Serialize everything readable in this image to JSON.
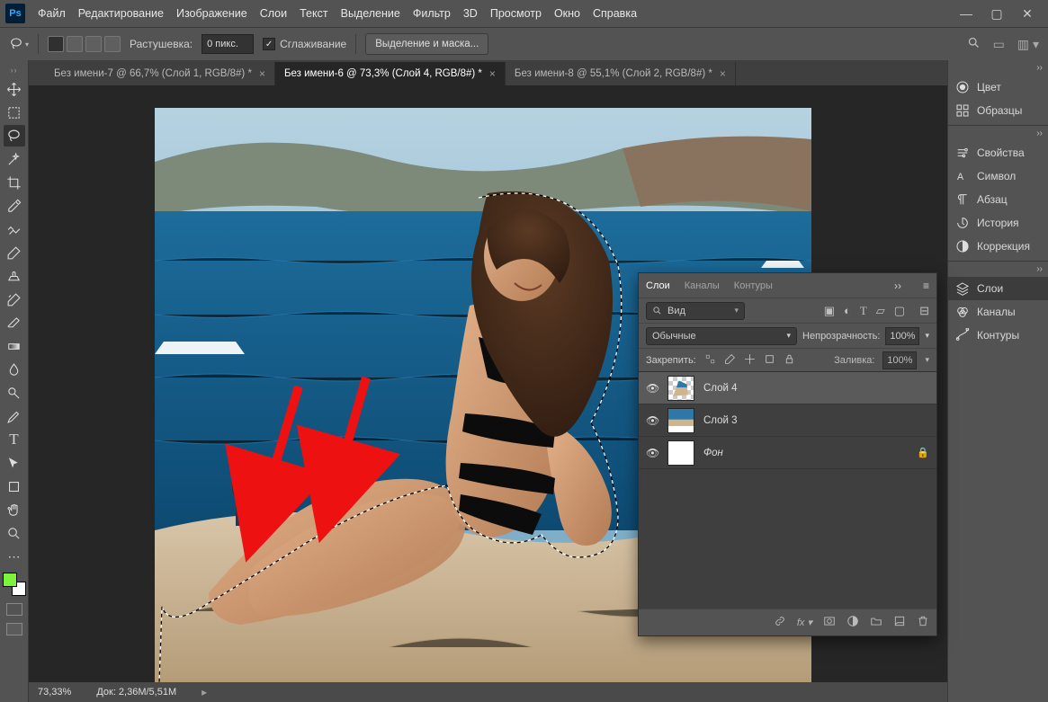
{
  "menu": {
    "items": [
      "Файл",
      "Редактирование",
      "Изображение",
      "Слои",
      "Текст",
      "Выделение",
      "Фильтр",
      "3D",
      "Просмотр",
      "Окно",
      "Справка"
    ]
  },
  "options": {
    "feather_label": "Растушевка:",
    "feather_value": "0 пикс.",
    "antialias": "Сглаживание",
    "mask_button": "Выделение и маска..."
  },
  "tabs": [
    {
      "label": "Без имени-7 @ 66,7% (Слой 1, RGB/8#) *"
    },
    {
      "label": "Без имени-6 @ 73,3% (Слой 4, RGB/8#) *"
    },
    {
      "label": "Без имени-8 @ 55,1% (Слой 2, RGB/8#) *"
    }
  ],
  "active_tab": 1,
  "status": {
    "zoom": "73,33%",
    "doc": "Док: 2,36M/5,51M"
  },
  "right_side": {
    "g1": [
      {
        "icon": "color",
        "label": "Цвет"
      },
      {
        "icon": "swatch",
        "label": "Образцы"
      }
    ],
    "g2": [
      {
        "icon": "props",
        "label": "Свойства"
      },
      {
        "icon": "char",
        "label": "Символ"
      },
      {
        "icon": "para",
        "label": "Абзац"
      },
      {
        "icon": "hist",
        "label": "История"
      },
      {
        "icon": "adj",
        "label": "Коррекция"
      }
    ],
    "g3": [
      {
        "icon": "layers",
        "label": "Слои"
      },
      {
        "icon": "chan",
        "label": "Каналы"
      },
      {
        "icon": "paths",
        "label": "Контуры"
      }
    ],
    "active": "Слои"
  },
  "layers_panel": {
    "tabs": [
      "Слои",
      "Каналы",
      "Контуры"
    ],
    "filter_kind": "Вид",
    "blend": "Обычные",
    "opacity_label": "Непрозрачность:",
    "opacity_value": "100%",
    "lock_label": "Закрепить:",
    "fill_label": "Заливка:",
    "fill_value": "100%",
    "layers": [
      {
        "name": "Слой 4",
        "thumb": "checker-photo",
        "selected": true
      },
      {
        "name": "Слой 3",
        "thumb": "photo"
      },
      {
        "name": "Фон",
        "thumb": "white",
        "locked": true,
        "italic": true
      }
    ]
  }
}
